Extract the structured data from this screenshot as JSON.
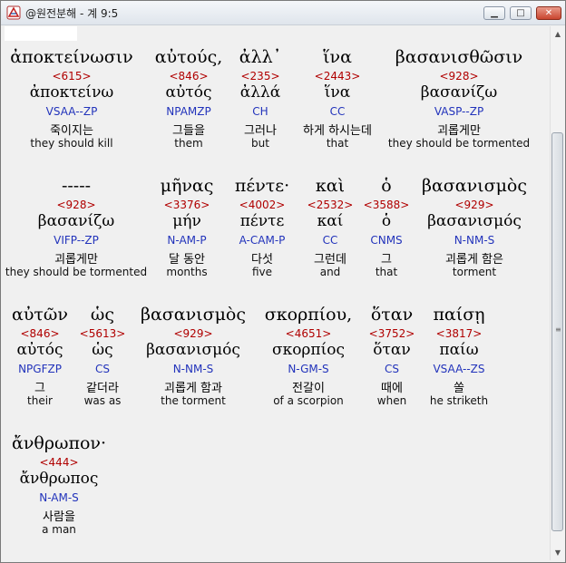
{
  "window": {
    "title": "@원전분해 - 계 9:5",
    "minimize_label": "▁",
    "maximize_label": "□",
    "close_label": "✕"
  },
  "rows": [
    [
      {
        "greek": "ἀποκτείνωσιν",
        "strong": "<615>",
        "lemma": "ἀποκτείνω",
        "parse": "VSAA--ZP",
        "korean": "죽이지는",
        "english": "they should kill"
      },
      {
        "greek": "αὐτούς,",
        "strong": "<846>",
        "lemma": "αὐτός",
        "parse": "NPAMZP",
        "korean": "그들을",
        "english": "them"
      },
      {
        "greek": "ἀλλ᾽",
        "strong": "<235>",
        "lemma": "ἀλλά",
        "parse": "CH",
        "korean": "그러나",
        "english": "but"
      },
      {
        "greek": "ἵνα",
        "strong": "<2443>",
        "lemma": "ἵνα",
        "parse": "CC",
        "korean": "하게 하시는데",
        "english": "that"
      },
      {
        "greek": "βασανισθῶσιν",
        "strong": "<928>",
        "lemma": "βασανίζω",
        "parse": "VASP--ZP",
        "korean": "괴롭게만",
        "english": "they should be tormented"
      }
    ],
    [
      {
        "greek": "-----",
        "strong": "<928>",
        "lemma": "βασανίζω",
        "parse": "VIFP--ZP",
        "korean": "괴롭게만",
        "english": "they should be tormented"
      },
      {
        "greek": "μῆνας",
        "strong": "<3376>",
        "lemma": "μήν",
        "parse": "N-AM-P",
        "korean": "달 동안",
        "english": "months"
      },
      {
        "greek": "πέντε·",
        "strong": "<4002>",
        "lemma": "πέντε",
        "parse": "A-CAM-P",
        "korean": "다섯",
        "english": "five"
      },
      {
        "greek": "καὶ",
        "strong": "<2532>",
        "lemma": "καί",
        "parse": "CC",
        "korean": "그런데",
        "english": "and"
      },
      {
        "greek": "ὁ",
        "strong": "<3588>",
        "lemma": "ὁ",
        "parse": "CNMS",
        "korean": "그",
        "english": "that"
      },
      {
        "greek": "βασανισμὸς",
        "strong": "<929>",
        "lemma": "βασανισμός",
        "parse": "N-NM-S",
        "korean": "괴롭게 함은",
        "english": "torment"
      }
    ],
    [
      {
        "greek": "αὐτῶν",
        "strong": "<846>",
        "lemma": "αὐτός",
        "parse": "NPGFZP",
        "korean": "그",
        "english": "their"
      },
      {
        "greek": "ὡς",
        "strong": "<5613>",
        "lemma": "ὡς",
        "parse": "CS",
        "korean": "같더라",
        "english": "was as"
      },
      {
        "greek": "βασανισμὸς",
        "strong": "<929>",
        "lemma": "βασανισμός",
        "parse": "N-NM-S",
        "korean": "괴롭게 함과",
        "english": "the torment"
      },
      {
        "greek": "σκορπίου,",
        "strong": "<4651>",
        "lemma": "σκορπίος",
        "parse": "N-GM-S",
        "korean": "전갈이",
        "english": "of a scorpion"
      },
      {
        "greek": "ὅταν",
        "strong": "<3752>",
        "lemma": "ὅταν",
        "parse": "CS",
        "korean": "때에",
        "english": "when"
      },
      {
        "greek": "παίσῃ",
        "strong": "<3817>",
        "lemma": "παίω",
        "parse": "VSAA--ZS",
        "korean": "쏠",
        "english": "he striketh"
      }
    ],
    [
      {
        "greek": "ἄνθρωπον·",
        "strong": "<444>",
        "lemma": "ἄνθρωπος",
        "parse": "N-AM-S",
        "korean": "사람을",
        "english": "a man"
      }
    ]
  ]
}
